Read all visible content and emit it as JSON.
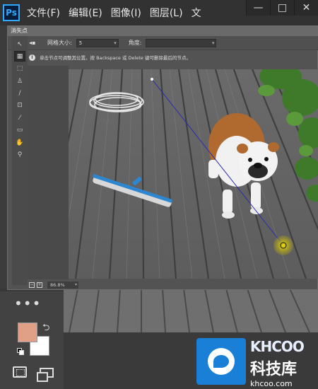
{
  "app": {
    "logo": "Ps",
    "menu": [
      "文件(F)",
      "编辑(E)",
      "图像(I)",
      "图层(L)",
      "文"
    ],
    "window_controls": [
      "—",
      "□",
      "✕"
    ]
  },
  "dialog": {
    "title": "消失点",
    "options": {
      "grid_label": "网格大小:",
      "grid_value": "5",
      "angle_label": "角度:",
      "angle_value": ""
    },
    "info_text": "单击节点可调整其位置。按 Backspace 或 Delete 键可删除最后的节点。",
    "zoom": "86.8%",
    "tools": [
      "edit-plane",
      "create-plane",
      "marquee",
      "stamp",
      "brush",
      "transform",
      "eyedropper",
      "measure",
      "hand",
      "zoom"
    ]
  },
  "ps": {
    "more_tools": "•••",
    "foreground_color": "#e0a088",
    "background_color": "#ffffff"
  },
  "watermark": {
    "brand": "KHCOO",
    "cn": "科技库",
    "url": "khcoo.com"
  }
}
